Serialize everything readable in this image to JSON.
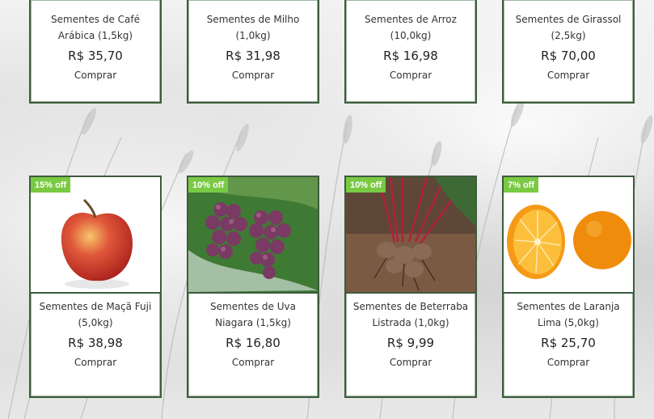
{
  "top_row": [
    {
      "name": "Sementes de Café Arábica (1,5kg)",
      "price": "R$ 35,70",
      "buy": "Comprar"
    },
    {
      "name": "Sementes de Milho (1,0kg)",
      "price": "R$ 31,98",
      "buy": "Comprar"
    },
    {
      "name": "Sementes de Arroz (10,0kg)",
      "price": "R$ 16,98",
      "buy": "Comprar"
    },
    {
      "name": "Sementes de Girassol (2,5kg)",
      "price": "R$ 70,00",
      "buy": "Comprar"
    }
  ],
  "bottom_row": [
    {
      "badge": "15% off",
      "name": "Sementes de Maçã Fuji (5,0kg)",
      "price": "R$ 38,98",
      "buy": "Comprar",
      "image": "apple"
    },
    {
      "badge": "10% off",
      "name": "Sementes de Uva Niagara (1,5kg)",
      "price": "R$ 16,80",
      "buy": "Comprar",
      "image": "grapes"
    },
    {
      "badge": "10% off",
      "name": "Sementes de Beterraba Listrada (1,0kg)",
      "price": "R$ 9,99",
      "buy": "Comprar",
      "image": "beets"
    },
    {
      "badge": "7% off",
      "name": "Sementes de Laranja Lima (5,0kg)",
      "price": "R$ 25,70",
      "buy": "Comprar",
      "image": "oranges"
    }
  ],
  "colors": {
    "badge": "#7ac943",
    "border": "#3d5c3d"
  }
}
